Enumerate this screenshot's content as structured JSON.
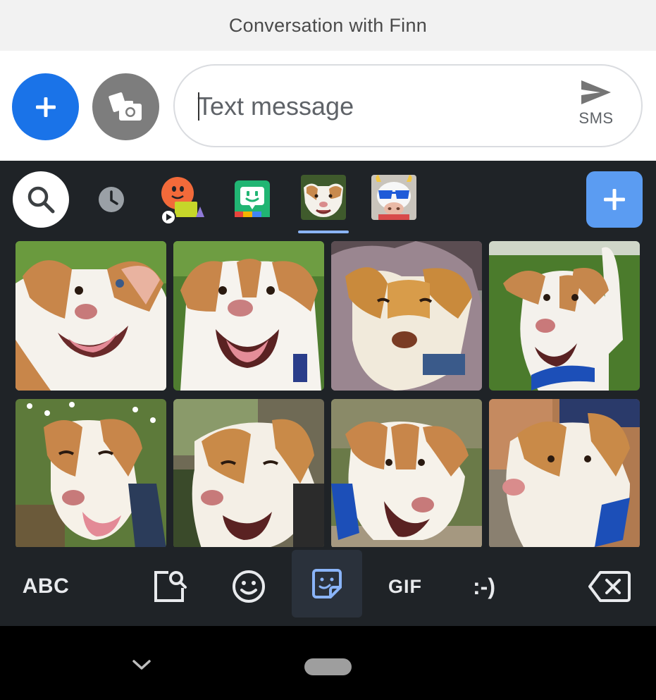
{
  "header": {
    "title": "Conversation with Finn"
  },
  "compose": {
    "placeholder": "Text message",
    "send_label": "SMS",
    "accent": "#1a73e8"
  },
  "keyboard": {
    "tabs": [
      {
        "name": "search"
      },
      {
        "name": "recent"
      },
      {
        "name": "sticker-pack-bitmoji-characters"
      },
      {
        "name": "bitmoji-app"
      },
      {
        "name": "sticker-pack-dog-photos",
        "selected": true
      },
      {
        "name": "sticker-pack-cow-sunglasses"
      }
    ],
    "stickers": [
      {
        "name": "dog-sticker-1"
      },
      {
        "name": "dog-sticker-2"
      },
      {
        "name": "dog-sticker-3"
      },
      {
        "name": "dog-sticker-4"
      },
      {
        "name": "dog-sticker-5"
      },
      {
        "name": "dog-sticker-6"
      },
      {
        "name": "dog-sticker-7"
      },
      {
        "name": "dog-sticker-8"
      }
    ],
    "bottom": {
      "abc_label": "ABC",
      "gif_label": "GIF",
      "emoticon_label": ":-)"
    },
    "active_tab_color": "#8ab4f8"
  }
}
